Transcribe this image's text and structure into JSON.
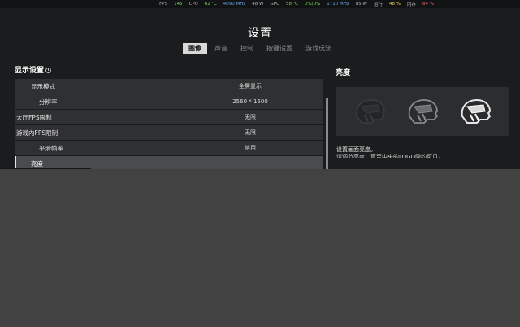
{
  "overlay": {
    "items": [
      {
        "text": "FPS",
        "color": "#b8b8b8"
      },
      {
        "text": "145",
        "color": "#7ddc5a"
      },
      {
        "text": "CPU",
        "color": "#b8b8b8"
      },
      {
        "text": "62 ℃",
        "color": "#7ddc5a"
      },
      {
        "text": "4090 MHz",
        "color": "#6aa8e8"
      },
      {
        "text": "48 W",
        "color": "#b8b8b8"
      },
      {
        "text": "GPU",
        "color": "#b8b8b8"
      },
      {
        "text": "58 ℃",
        "color": "#7ddc5a"
      },
      {
        "text": "0%/0%",
        "color": "#7ddc5a"
      },
      {
        "text": "1710 MHz",
        "color": "#6aa8e8"
      },
      {
        "text": "85 W",
        "color": "#b8b8b8"
      },
      {
        "text": "运行",
        "color": "#b8b8b8"
      },
      {
        "text": "48 %",
        "color": "#e8d25a"
      },
      {
        "text": "内存",
        "color": "#b8b8b8"
      },
      {
        "text": "84 %",
        "color": "#e86a6a"
      }
    ]
  },
  "header": {
    "title": "设置",
    "tabs": [
      {
        "label": "图像",
        "active": true
      },
      {
        "label": "声音",
        "active": false
      },
      {
        "label": "控制",
        "active": false
      },
      {
        "label": "按键设置",
        "active": false
      },
      {
        "label": "游戏玩法",
        "active": false
      }
    ]
  },
  "display_settings": {
    "title": "显示设置",
    "info_icon": "info-icon",
    "rows": [
      {
        "label": "显示模式",
        "value": "全屏显示"
      },
      {
        "label": "分辨率",
        "value": "2560 * 1600"
      },
      {
        "label": "大厅FPS限制",
        "value": "无限"
      },
      {
        "label": "游戏内FPS限制",
        "value": "无限"
      },
      {
        "label": "平滑帧率",
        "value": "禁用"
      },
      {
        "label": "亮度",
        "value": ""
      }
    ]
  },
  "brightness_panel": {
    "title": "亮度",
    "helmet_icons": [
      "helmet-dark-icon",
      "helmet-medium-icon",
      "helmet-bright-icon"
    ],
    "description_line1": "设置画面亮度。",
    "description_line2": "请调节亮度，直至中央的LOGO隐约可见。"
  }
}
